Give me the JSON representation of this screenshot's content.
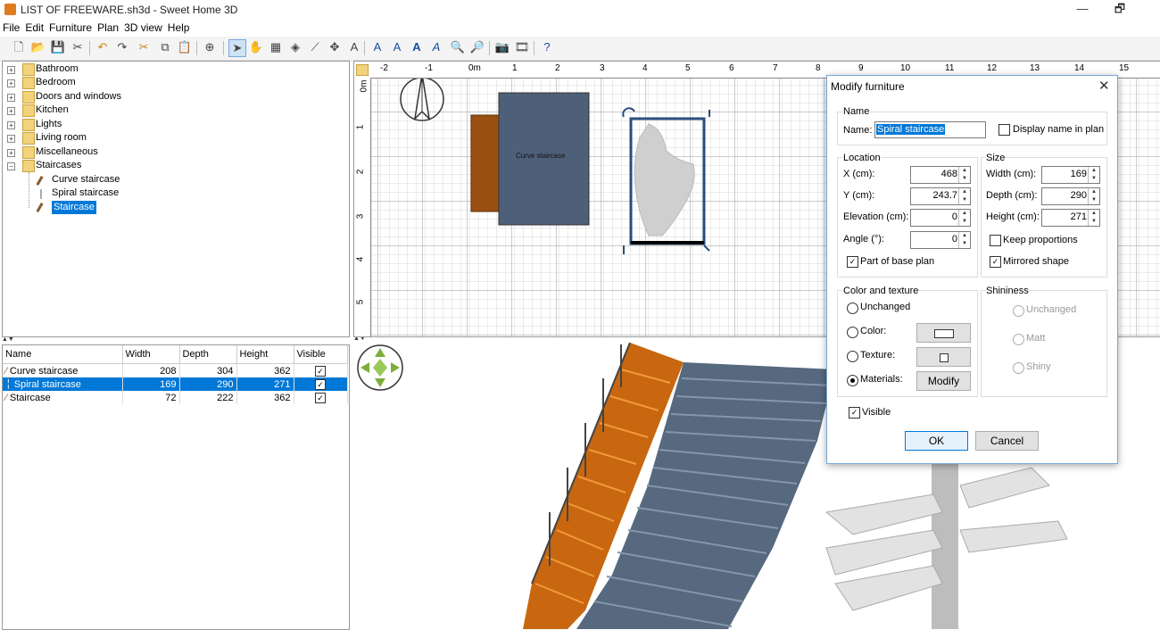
{
  "window": {
    "title": "LIST OF FREEWARE.sh3d - Sweet Home 3D",
    "min": "—",
    "max": "🗗",
    "close": "✕"
  },
  "menu": [
    "File",
    "Edit",
    "Furniture",
    "Plan",
    "3D view",
    "Help"
  ],
  "catalog": {
    "categories": [
      "Bathroom",
      "Bedroom",
      "Doors and windows",
      "Kitchen",
      "Lights",
      "Living room",
      "Miscellaneous",
      "Staircases"
    ],
    "staircases": [
      "Curve staircase",
      "Spiral staircase",
      "Staircase"
    ]
  },
  "table": {
    "headers": [
      "Name",
      "Width",
      "Depth",
      "Height",
      "Visible"
    ],
    "rows": [
      {
        "name": "Curve staircase",
        "width": "208",
        "depth": "304",
        "height": "362"
      },
      {
        "name": "Spiral staircase",
        "width": "169",
        "depth": "290",
        "height": "271"
      },
      {
        "name": "Staircase",
        "width": "72",
        "depth": "222",
        "height": "362"
      }
    ]
  },
  "plan": {
    "hruler": [
      "-2",
      "-1",
      "0m",
      "1",
      "2",
      "3",
      "4",
      "5",
      "6",
      "7",
      "8",
      "9",
      "10",
      "11",
      "12",
      "13",
      "14",
      "15"
    ],
    "vruler": [
      "0m",
      "1",
      "2",
      "3",
      "4",
      "5"
    ],
    "curve_label": "Curve staircase"
  },
  "dialog": {
    "title": "Modify furniture",
    "name_group": "Name",
    "name_label": "Name:",
    "name_value": "Spiral staircase",
    "display_name": "Display name in plan",
    "location_group": "Location",
    "x_label": "X (cm):",
    "x_value": "468",
    "y_label": "Y (cm):",
    "y_value": "243.7",
    "elev_label": "Elevation (cm):",
    "elev_value": "0",
    "angle_label": "Angle (°):",
    "angle_value": "0",
    "base_plan": "Part of base plan",
    "size_group": "Size",
    "width_label": "Width (cm):",
    "width_value": "169",
    "depth_label": "Depth (cm):",
    "depth_value": "290",
    "height_label": "Height (cm):",
    "height_value": "271",
    "keep_prop": "Keep proportions",
    "mirrored": "Mirrored shape",
    "color_group": "Color and texture",
    "unchanged": "Unchanged",
    "color": "Color:",
    "texture": "Texture:",
    "materials": "Materials:",
    "modify": "Modify",
    "shininess_group": "Shininess",
    "sh_unchanged": "Unchanged",
    "matt": "Matt",
    "shiny": "Shiny",
    "visible": "Visible",
    "ok": "OK",
    "cancel": "Cancel"
  }
}
